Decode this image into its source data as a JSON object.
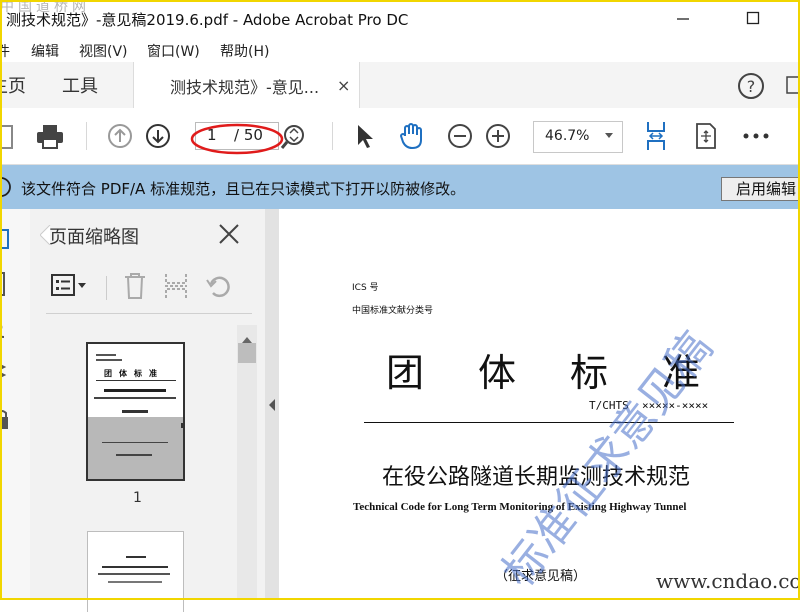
{
  "window": {
    "title": "测技术规范》-意见稿2019.6.pdf - Adobe Acrobat Pro DC",
    "watermark_top_left": "中国道桥网"
  },
  "menu": [
    "件",
    "编辑",
    "视图(V)",
    "窗口(W)",
    "帮助(H)"
  ],
  "tabs": {
    "home": "主页",
    "tools": "工具",
    "document": "测技术规范》-意见...",
    "close": "×"
  },
  "toolbar": {
    "page_current": "1",
    "page_total": "/ 50",
    "zoom": "46.7%"
  },
  "notice": {
    "text": "该文件符合 PDF/A 标准规范，且已在只读模式下打开以防被修改。",
    "button": "启用编辑"
  },
  "thumbnails": {
    "title": "页面缩略图",
    "page1_label": "1"
  },
  "document": {
    "ics": "ICS 号",
    "class_no": "中国标准文献分类号",
    "big_title": [
      "团",
      "体",
      "标",
      "准"
    ],
    "code": "T/CHTS  ×××××-××××",
    "cn_title": "在役公路隧道长期监测技术规范",
    "en_title": "Technical Code for Long Term Monitoring of Existing Highway Tunnel",
    "draft": "（征求意见稿）",
    "watermark": "标准征求意见稿",
    "site_watermark": "www.cndao.com"
  }
}
